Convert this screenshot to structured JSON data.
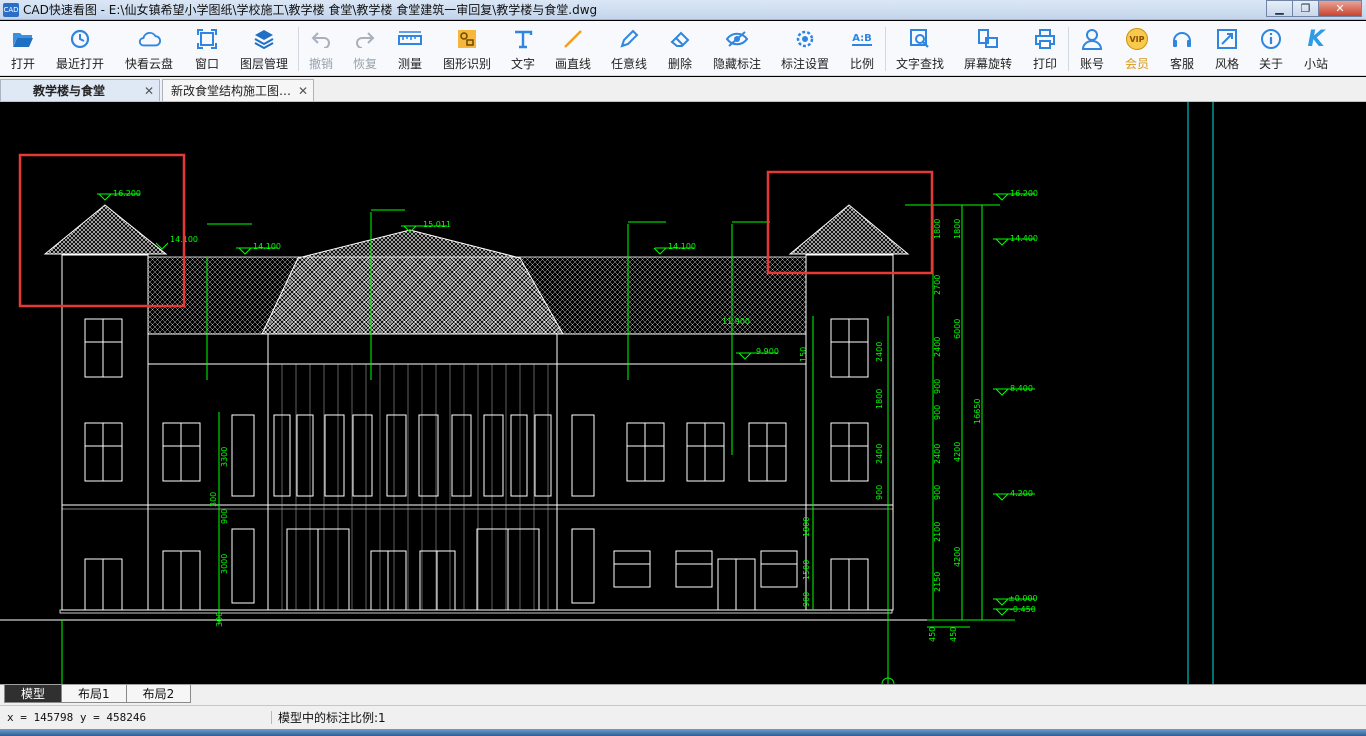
{
  "window": {
    "icon_text": "CAD",
    "title": "CAD快速看图 - E:\\仙女镇希望小学图纸\\学校施工\\教学楼 食堂\\教学楼 食堂建筑一审回复\\教学楼与食堂.dwg",
    "min_glyph": "▁",
    "max_glyph": "❐",
    "close_glyph": "✕"
  },
  "toolbar": {
    "items": [
      {
        "label": "打开",
        "icon": "folder-open-icon",
        "disabled": false
      },
      {
        "label": "最近打开",
        "icon": "clock-icon",
        "disabled": false
      },
      {
        "label": "快看云盘",
        "icon": "cloud-icon",
        "disabled": false
      },
      {
        "label": "窗口",
        "icon": "window-frame-icon",
        "disabled": false
      },
      {
        "label": "图层管理",
        "icon": "layers-icon",
        "disabled": false
      },
      {
        "label": "撤销",
        "icon": "undo-icon",
        "disabled": true
      },
      {
        "label": "恢复",
        "icon": "redo-icon",
        "disabled": true
      },
      {
        "label": "测量",
        "icon": "ruler-icon",
        "disabled": false
      },
      {
        "label": "图形识别",
        "icon": "shape-recognize-icon",
        "disabled": false
      },
      {
        "label": "文字",
        "icon": "text-icon",
        "disabled": false
      },
      {
        "label": "画直线",
        "icon": "line-icon",
        "disabled": false
      },
      {
        "label": "任意线",
        "icon": "pen-icon",
        "disabled": false
      },
      {
        "label": "删除",
        "icon": "eraser-icon",
        "disabled": false
      },
      {
        "label": "隐藏标注",
        "icon": "eye-hide-icon",
        "disabled": false
      },
      {
        "label": "标注设置",
        "icon": "annotation-settings-icon",
        "disabled": false
      },
      {
        "label": "比例",
        "icon": "ratio-icon",
        "disabled": false
      },
      {
        "label": "文字查找",
        "icon": "text-search-icon",
        "disabled": false
      },
      {
        "label": "屏幕旋转",
        "icon": "rotate-screen-icon",
        "disabled": false
      },
      {
        "label": "打印",
        "icon": "printer-icon",
        "disabled": false
      },
      {
        "label": "账号",
        "icon": "user-icon",
        "disabled": false
      },
      {
        "label": "会员",
        "icon": "vip-icon",
        "disabled": false
      },
      {
        "label": "客服",
        "icon": "headset-icon",
        "disabled": false
      },
      {
        "label": "风格",
        "icon": "style-icon",
        "disabled": false
      },
      {
        "label": "关于",
        "icon": "info-icon",
        "disabled": false
      },
      {
        "label": "小站",
        "icon": "k-logo-icon",
        "disabled": false
      }
    ],
    "ratio_icon_text": "A:B",
    "vip_icon_text": "VIP",
    "k_icon_text": "K"
  },
  "doc_tabs": [
    {
      "label": "教学楼与食堂",
      "active": true
    },
    {
      "label": "新改食堂结构施工图…",
      "active": false
    }
  ],
  "tab_close_glyph": "✕",
  "drawing": {
    "elevations_left": [
      "16.200",
      "14.100",
      "14.100",
      "15.011"
    ],
    "elevations_right": [
      "14.100",
      "11.900",
      "9.900"
    ],
    "right_axis_labels": [
      "16.200",
      "14.400",
      "8.400",
      "4.200",
      "±0.000",
      "-0.450"
    ],
    "dims_inner": [
      "2400",
      "1800",
      "2400",
      "900",
      "1800",
      "1500",
      "900"
    ],
    "dims_col2": [
      "1800",
      "2700",
      "2400",
      "900",
      "900",
      "2400",
      "900",
      "2100",
      "2150"
    ],
    "dims_col3": [
      "1800",
      "6000",
      "4200",
      "4200"
    ],
    "dims_total": "16650",
    "dims_bottom": [
      "450",
      "450"
    ],
    "dims_left": [
      "3300",
      "900",
      "3000",
      "300",
      "300"
    ],
    "dim_150": "150",
    "dim_11900": "11.900",
    "colors": {
      "lines": "#ffffff",
      "dims": "#00ff00",
      "highlight": "#e53935",
      "cyan": "#00e5e5"
    }
  },
  "layout_tabs": [
    "模型",
    "布局1",
    "布局2"
  ],
  "status": {
    "coordinates": "x = 145798 y = 458246",
    "scale_text": "模型中的标注比例:1"
  }
}
